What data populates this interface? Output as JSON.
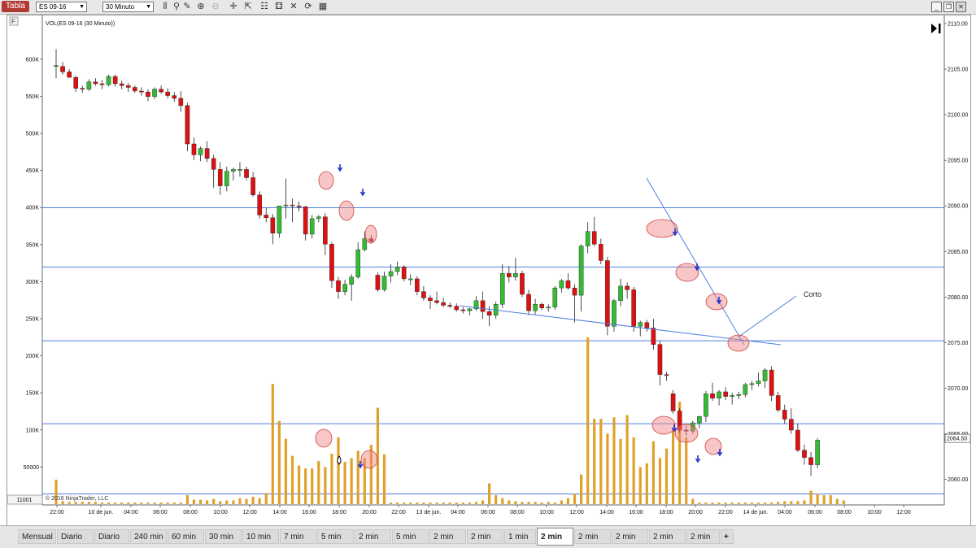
{
  "toolbar": {
    "app_tab": "Tabla",
    "instrument": "ES 09-16",
    "interval": "30 Minuto",
    "icons": [
      "bar-chart-icon",
      "search-icon",
      "pencil-icon",
      "zoom-in-icon",
      "zoom-out-icon",
      "crosshair-icon",
      "cursor-icon",
      "properties-icon",
      "indicators-icon",
      "strategies-icon",
      "refresh-icon"
    ]
  },
  "chart": {
    "indicator_label": "VOL(ES 09-16 (30 Minuto))",
    "copyright": "© 2016 NinjaTrader, LLC",
    "panel_marker": "F",
    "volume_box": "11001",
    "annotation": "Corto",
    "current_price": "2064.50",
    "colors": {
      "up": "#33bb33",
      "down": "#dd1111",
      "volume": "#e0a12a",
      "hline": "#4f7fdf",
      "trend": "#4f7fdf",
      "circle": "#f08080",
      "arrow": "#2233cc"
    },
    "price_axis": {
      "min": 2058,
      "max": 2110,
      "ticks": [
        "2110.00",
        "2105.00",
        "2100.00",
        "2095.00",
        "2090.00",
        "2085.00",
        "2080.00",
        "2075.00",
        "2070.00",
        "2065.00",
        "2060.00"
      ]
    },
    "volume_axis": {
      "ticks": [
        "600K",
        "550K",
        "500K",
        "450K",
        "400K",
        "350K",
        "300K",
        "250K",
        "200K",
        "150K",
        "100K",
        "50000"
      ]
    },
    "time_labels": [
      "22:00",
      "10 de jun.",
      "04:00",
      "06:00",
      "08:00",
      "10:00",
      "12:00",
      "14:00",
      "16:00",
      "18:00",
      "20:00",
      "22:00",
      "13 de jun.",
      "04:00",
      "06:00",
      "08:00",
      "10:00",
      "12:00",
      "14:00",
      "16:00",
      "18:00",
      "20:00",
      "22:00",
      "14 de jun.",
      "04:00",
      "06:00",
      "08:00",
      "10:00",
      "12:00"
    ]
  },
  "chart_data": {
    "type": "candlestick",
    "price_levels": [
      2089.8,
      2083.3,
      2075.2,
      2066.1,
      2058.4
    ],
    "candles": [
      {
        "o": 2105.3,
        "h": 2107.2,
        "l": 2104.0,
        "c": 2105.4
      },
      {
        "o": 2105.3,
        "h": 2105.8,
        "l": 2104.4,
        "c": 2104.7
      },
      {
        "o": 2104.7,
        "h": 2105.0,
        "l": 2104.1,
        "c": 2104.1
      },
      {
        "o": 2104.1,
        "h": 2104.3,
        "l": 2102.5,
        "c": 2102.9
      },
      {
        "o": 2102.9,
        "h": 2103.2,
        "l": 2102.4,
        "c": 2102.8
      },
      {
        "o": 2102.8,
        "h": 2103.9,
        "l": 2102.6,
        "c": 2103.6
      },
      {
        "o": 2103.6,
        "h": 2104.0,
        "l": 2103.2,
        "c": 2103.4
      },
      {
        "o": 2103.4,
        "h": 2103.8,
        "l": 2102.8,
        "c": 2103.3
      },
      {
        "o": 2103.3,
        "h": 2104.4,
        "l": 2103.1,
        "c": 2104.2
      },
      {
        "o": 2104.2,
        "h": 2104.4,
        "l": 2103.1,
        "c": 2103.4
      },
      {
        "o": 2103.4,
        "h": 2103.7,
        "l": 2102.8,
        "c": 2103.2
      },
      {
        "o": 2103.2,
        "h": 2103.5,
        "l": 2102.5,
        "c": 2103.0
      },
      {
        "o": 2103.0,
        "h": 2103.2,
        "l": 2102.4,
        "c": 2102.6
      },
      {
        "o": 2102.6,
        "h": 2103.0,
        "l": 2102.1,
        "c": 2102.5
      },
      {
        "o": 2102.5,
        "h": 2102.8,
        "l": 2101.5,
        "c": 2102.0
      },
      {
        "o": 2102.0,
        "h": 2103.0,
        "l": 2101.7,
        "c": 2102.8
      },
      {
        "o": 2102.8,
        "h": 2103.2,
        "l": 2102.3,
        "c": 2102.5
      },
      {
        "o": 2102.5,
        "h": 2102.9,
        "l": 2101.8,
        "c": 2102.1
      },
      {
        "o": 2102.1,
        "h": 2102.5,
        "l": 2101.4,
        "c": 2101.8
      },
      {
        "o": 2101.8,
        "h": 2102.6,
        "l": 2100.3,
        "c": 2101.0
      },
      {
        "o": 2101.0,
        "h": 2101.3,
        "l": 2096.0,
        "c": 2096.8
      },
      {
        "o": 2096.8,
        "h": 2097.5,
        "l": 2095.0,
        "c": 2095.6
      },
      {
        "o": 2095.6,
        "h": 2096.5,
        "l": 2094.9,
        "c": 2096.3
      },
      {
        "o": 2096.3,
        "h": 2097.1,
        "l": 2094.8,
        "c": 2095.2
      },
      {
        "o": 2095.2,
        "h": 2095.6,
        "l": 2092.0,
        "c": 2094.0
      },
      {
        "o": 2094.0,
        "h": 2094.8,
        "l": 2091.2,
        "c": 2092.2
      },
      {
        "o": 2092.2,
        "h": 2094.3,
        "l": 2091.6,
        "c": 2093.8
      },
      {
        "o": 2093.8,
        "h": 2094.2,
        "l": 2092.8,
        "c": 2094.0
      },
      {
        "o": 2094.0,
        "h": 2094.8,
        "l": 2093.2,
        "c": 2094.0
      },
      {
        "o": 2094.0,
        "h": 2094.3,
        "l": 2092.8,
        "c": 2093.1
      },
      {
        "o": 2093.1,
        "h": 2093.7,
        "l": 2091.0,
        "c": 2091.2
      },
      {
        "o": 2091.2,
        "h": 2091.6,
        "l": 2088.6,
        "c": 2089.0
      },
      {
        "o": 2089.0,
        "h": 2089.8,
        "l": 2088.2,
        "c": 2088.7
      },
      {
        "o": 2088.7,
        "h": 2089.1,
        "l": 2085.8,
        "c": 2087.0
      },
      {
        "o": 2087.0,
        "h": 2090.0,
        "l": 2086.5,
        "c": 2090.0
      },
      {
        "o": 2090.0,
        "h": 2093.0,
        "l": 2088.6,
        "c": 2090.1
      },
      {
        "o": 2090.1,
        "h": 2090.8,
        "l": 2088.2,
        "c": 2090.0
      },
      {
        "o": 2090.0,
        "h": 2090.5,
        "l": 2089.4,
        "c": 2089.9
      },
      {
        "o": 2089.9,
        "h": 2090.0,
        "l": 2086.2,
        "c": 2086.9
      },
      {
        "o": 2086.9,
        "h": 2089.0,
        "l": 2086.4,
        "c": 2088.6
      },
      {
        "o": 2088.6,
        "h": 2089.0,
        "l": 2088.2,
        "c": 2088.8
      },
      {
        "o": 2088.8,
        "h": 2089.2,
        "l": 2084.6,
        "c": 2085.8
      },
      {
        "o": 2085.8,
        "h": 2086.0,
        "l": 2081.0,
        "c": 2081.8
      },
      {
        "o": 2081.8,
        "h": 2082.2,
        "l": 2079.8,
        "c": 2080.6
      },
      {
        "o": 2080.6,
        "h": 2081.9,
        "l": 2080.2,
        "c": 2081.4
      },
      {
        "o": 2081.4,
        "h": 2082.5,
        "l": 2079.6,
        "c": 2082.2
      },
      {
        "o": 2082.2,
        "h": 2086.0,
        "l": 2082.0,
        "c": 2085.2
      },
      {
        "o": 2085.2,
        "h": 2087.2,
        "l": 2085.0,
        "c": 2086.4
      },
      {
        "o": 2086.4,
        "h": 2086.8,
        "l": 2085.9,
        "c": 2086.1
      },
      {
        "o": 2082.4,
        "h": 2082.7,
        "l": 2080.6,
        "c": 2080.8
      },
      {
        "o": 2080.8,
        "h": 2082.8,
        "l": 2080.6,
        "c": 2082.3
      },
      {
        "o": 2082.3,
        "h": 2083.6,
        "l": 2081.6,
        "c": 2082.8
      },
      {
        "o": 2082.8,
        "h": 2083.9,
        "l": 2082.4,
        "c": 2083.3
      },
      {
        "o": 2083.3,
        "h": 2083.5,
        "l": 2081.7,
        "c": 2082.0
      },
      {
        "o": 2082.0,
        "h": 2082.5,
        "l": 2081.3,
        "c": 2082.0
      },
      {
        "o": 2082.0,
        "h": 2082.3,
        "l": 2080.2,
        "c": 2080.6
      },
      {
        "o": 2080.6,
        "h": 2081.2,
        "l": 2079.6,
        "c": 2079.9
      },
      {
        "o": 2079.9,
        "h": 2080.2,
        "l": 2078.7,
        "c": 2079.6
      },
      {
        "o": 2079.6,
        "h": 2080.6,
        "l": 2079.2,
        "c": 2079.4
      },
      {
        "o": 2079.4,
        "h": 2079.9,
        "l": 2078.9,
        "c": 2079.1
      },
      {
        "o": 2079.1,
        "h": 2079.4,
        "l": 2078.8,
        "c": 2079.0
      },
      {
        "o": 2079.0,
        "h": 2079.3,
        "l": 2078.4,
        "c": 2078.6
      },
      {
        "o": 2078.6,
        "h": 2078.9,
        "l": 2078.2,
        "c": 2078.5
      },
      {
        "o": 2078.5,
        "h": 2078.8,
        "l": 2078.0,
        "c": 2078.7
      },
      {
        "o": 2078.7,
        "h": 2080.1,
        "l": 2078.5,
        "c": 2079.6
      },
      {
        "o": 2079.6,
        "h": 2080.6,
        "l": 2077.6,
        "c": 2078.4
      },
      {
        "o": 2078.4,
        "h": 2079.0,
        "l": 2076.8,
        "c": 2078.0
      },
      {
        "o": 2078.0,
        "h": 2079.5,
        "l": 2077.6,
        "c": 2079.2
      },
      {
        "o": 2079.2,
        "h": 2083.6,
        "l": 2078.8,
        "c": 2082.6
      },
      {
        "o": 2082.6,
        "h": 2083.4,
        "l": 2081.6,
        "c": 2082.2
      },
      {
        "o": 2082.2,
        "h": 2084.3,
        "l": 2081.8,
        "c": 2082.6
      },
      {
        "o": 2082.6,
        "h": 2082.9,
        "l": 2080.0,
        "c": 2080.3
      },
      {
        "o": 2080.3,
        "h": 2080.8,
        "l": 2078.0,
        "c": 2078.5
      },
      {
        "o": 2078.5,
        "h": 2079.8,
        "l": 2078.1,
        "c": 2079.2
      },
      {
        "o": 2079.2,
        "h": 2079.4,
        "l": 2078.6,
        "c": 2078.8
      },
      {
        "o": 2078.8,
        "h": 2079.2,
        "l": 2078.4,
        "c": 2078.9
      },
      {
        "o": 2078.9,
        "h": 2081.2,
        "l": 2078.6,
        "c": 2081.0
      },
      {
        "o": 2081.0,
        "h": 2082.0,
        "l": 2080.5,
        "c": 2081.8
      },
      {
        "o": 2081.8,
        "h": 2082.6,
        "l": 2080.8,
        "c": 2081.0
      },
      {
        "o": 2081.0,
        "h": 2081.4,
        "l": 2077.2,
        "c": 2080.2
      },
      {
        "o": 2080.2,
        "h": 2085.8,
        "l": 2078.4,
        "c": 2085.6
      },
      {
        "o": 2085.6,
        "h": 2088.2,
        "l": 2084.8,
        "c": 2087.2
      },
      {
        "o": 2087.2,
        "h": 2088.8,
        "l": 2085.6,
        "c": 2085.8
      },
      {
        "o": 2085.8,
        "h": 2086.4,
        "l": 2083.6,
        "c": 2084.0
      },
      {
        "o": 2084.0,
        "h": 2084.4,
        "l": 2075.8,
        "c": 2076.8
      },
      {
        "o": 2076.8,
        "h": 2079.8,
        "l": 2076.2,
        "c": 2079.6
      },
      {
        "o": 2079.6,
        "h": 2082.0,
        "l": 2079.0,
        "c": 2081.2
      },
      {
        "o": 2081.2,
        "h": 2081.6,
        "l": 2079.8,
        "c": 2080.8
      },
      {
        "o": 2080.8,
        "h": 2081.1,
        "l": 2076.2,
        "c": 2076.8
      },
      {
        "o": 2076.8,
        "h": 2077.4,
        "l": 2075.7,
        "c": 2077.2
      },
      {
        "o": 2077.2,
        "h": 2077.5,
        "l": 2076.2,
        "c": 2076.6
      },
      {
        "o": 2076.6,
        "h": 2077.6,
        "l": 2074.2,
        "c": 2074.8
      },
      {
        "o": 2074.8,
        "h": 2075.2,
        "l": 2070.3,
        "c": 2071.5
      },
      {
        "o": 2071.5,
        "h": 2071.8,
        "l": 2070.8,
        "c": 2071.4
      },
      {
        "o": 2069.4,
        "h": 2069.8,
        "l": 2067.2,
        "c": 2067.5
      },
      {
        "o": 2067.5,
        "h": 2067.8,
        "l": 2065.1,
        "c": 2065.4
      },
      {
        "o": 2065.4,
        "h": 2065.9,
        "l": 2064.8,
        "c": 2065.3
      },
      {
        "o": 2065.3,
        "h": 2066.4,
        "l": 2065.0,
        "c": 2066.2
      },
      {
        "o": 2066.2,
        "h": 2067.0,
        "l": 2065.6,
        "c": 2066.9
      },
      {
        "o": 2066.9,
        "h": 2069.7,
        "l": 2066.3,
        "c": 2069.4
      },
      {
        "o": 2069.4,
        "h": 2070.6,
        "l": 2068.6,
        "c": 2068.9
      },
      {
        "o": 2068.9,
        "h": 2069.8,
        "l": 2068.1,
        "c": 2069.6
      },
      {
        "o": 2069.6,
        "h": 2070.1,
        "l": 2068.7,
        "c": 2069.1
      },
      {
        "o": 2069.1,
        "h": 2069.5,
        "l": 2068.2,
        "c": 2069.2
      },
      {
        "o": 2069.2,
        "h": 2069.6,
        "l": 2068.8,
        "c": 2069.3
      },
      {
        "o": 2069.3,
        "h": 2070.6,
        "l": 2069.0,
        "c": 2070.4
      },
      {
        "o": 2070.4,
        "h": 2070.8,
        "l": 2069.8,
        "c": 2070.5
      },
      {
        "o": 2070.5,
        "h": 2071.7,
        "l": 2070.2,
        "c": 2070.8
      },
      {
        "o": 2070.8,
        "h": 2072.2,
        "l": 2070.0,
        "c": 2072.0
      },
      {
        "o": 2072.0,
        "h": 2072.4,
        "l": 2068.6,
        "c": 2069.2
      },
      {
        "o": 2069.2,
        "h": 2069.6,
        "l": 2067.4,
        "c": 2067.6
      },
      {
        "o": 2067.6,
        "h": 2068.2,
        "l": 2066.1,
        "c": 2066.6
      },
      {
        "o": 2066.6,
        "h": 2067.8,
        "l": 2065.0,
        "c": 2065.4
      },
      {
        "o": 2065.4,
        "h": 2066.1,
        "l": 2063.0,
        "c": 2063.2
      },
      {
        "o": 2063.2,
        "h": 2063.8,
        "l": 2061.6,
        "c": 2062.4
      },
      {
        "o": 2062.4,
        "h": 2063.0,
        "l": 2060.4,
        "c": 2061.6
      },
      {
        "o": 2061.6,
        "h": 2064.5,
        "l": 2061.2,
        "c": 2064.3
      }
    ],
    "volume_k": [
      33,
      4,
      3,
      3,
      3,
      3,
      3,
      2,
      2,
      2,
      2,
      2,
      2,
      2,
      2,
      2,
      2,
      2,
      2,
      2,
      12,
      6,
      6,
      5,
      7,
      4,
      5,
      5,
      8,
      7,
      10,
      8,
      15,
      162,
      112,
      88,
      65,
      52,
      48,
      48,
      58,
      50,
      68,
      90,
      57,
      62,
      72,
      62,
      80,
      130,
      67,
      2,
      2,
      2,
      2,
      2,
      2,
      2,
      2,
      2,
      2,
      2,
      2,
      2,
      3,
      5,
      28,
      12,
      8,
      5,
      4,
      3,
      3,
      3,
      2,
      3,
      2,
      5,
      8,
      14,
      40,
      225,
      115,
      115,
      95,
      117,
      88,
      120,
      90,
      50,
      55,
      85,
      62,
      75,
      100,
      138,
      90,
      7,
      2,
      2,
      2,
      2,
      2,
      2,
      2,
      2,
      2,
      2,
      2,
      2,
      3,
      4,
      4,
      4,
      5,
      18,
      14,
      12,
      12,
      7,
      5
    ]
  },
  "interval_tabs": [
    {
      "label": "Mensual",
      "active": false
    },
    {
      "label": "Diario",
      "active": false
    },
    {
      "label": "Diario",
      "active": false
    },
    {
      "label": "240 min",
      "active": false
    },
    {
      "label": "60 min",
      "active": false
    },
    {
      "label": "30 min",
      "active": false
    },
    {
      "label": "10  min",
      "active": false
    },
    {
      "label": "7 min",
      "active": false
    },
    {
      "label": "5 min",
      "active": false
    },
    {
      "label": "2 min",
      "active": false
    },
    {
      "label": "5 min",
      "active": false
    },
    {
      "label": "2 min",
      "active": false
    },
    {
      "label": "2 min",
      "active": false
    },
    {
      "label": "1 min",
      "active": false
    },
    {
      "label": "2 min",
      "active": true
    },
    {
      "label": "2 min",
      "active": false
    },
    {
      "label": "2 min",
      "active": false
    },
    {
      "label": "2 min",
      "active": false
    },
    {
      "label": "2 min",
      "active": false
    },
    {
      "label": "+",
      "active": false
    }
  ]
}
